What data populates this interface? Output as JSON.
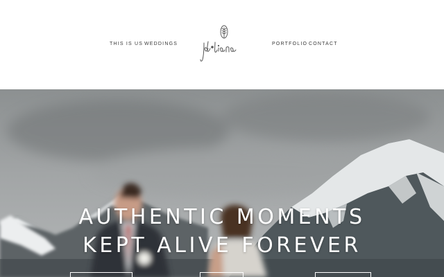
{
  "header": {
    "nav_left": [
      "THIS IS US",
      "WEDDINGS"
    ],
    "nav_right": [
      "PORTFOLIO",
      "CONTACT"
    ],
    "logo_text": "jd·liana"
  },
  "hero": {
    "headline_line1": "AUTHENTIC MOMENTS",
    "headline_line2": "KEPT ALIVE FOREVER"
  },
  "colors": {
    "header_bg": "#ffffff",
    "nav_text": "#3a3a3a",
    "headline": "#ffffff"
  }
}
